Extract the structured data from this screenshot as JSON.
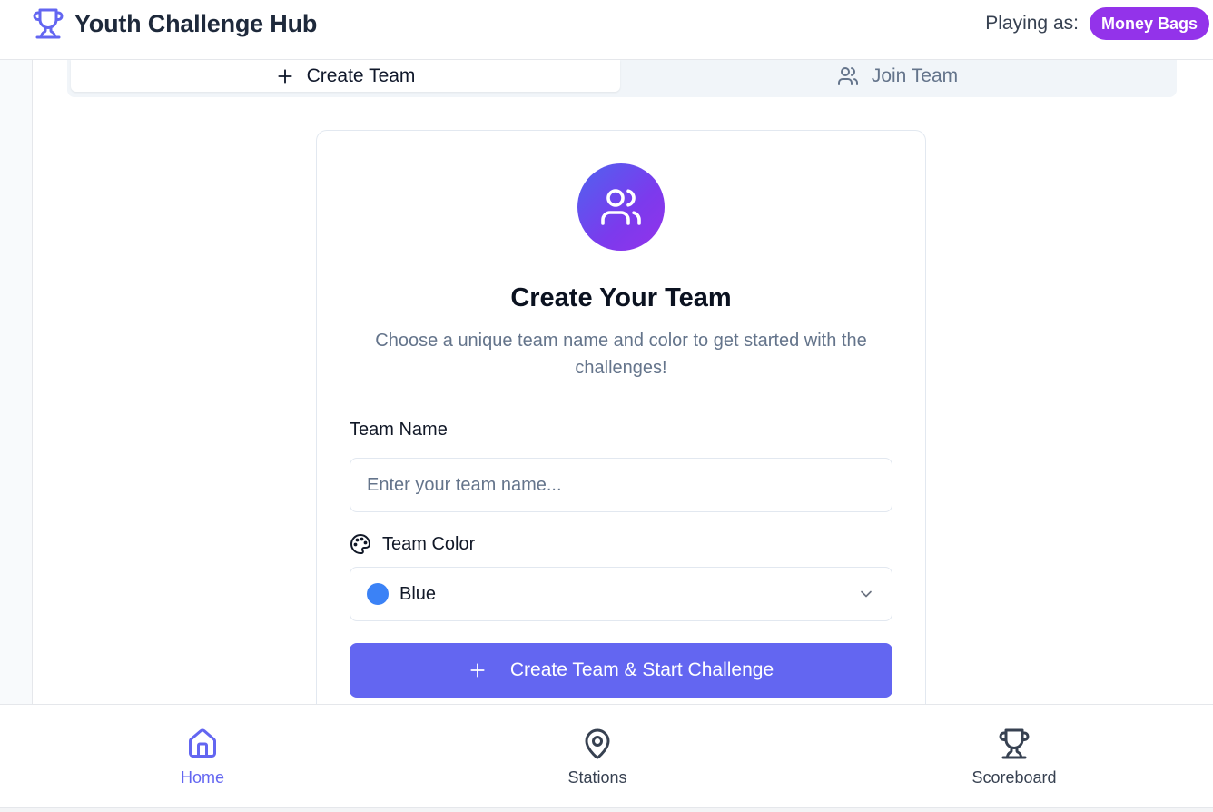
{
  "header": {
    "title": "Youth Challenge Hub",
    "playing_as_label": "Playing as:",
    "player_name": "Money Bags",
    "brand_icon": "trophy-icon"
  },
  "tabs": [
    {
      "label": "Create Team",
      "icon": "plus-icon",
      "active": true
    },
    {
      "label": "Join Team",
      "icon": "users-icon",
      "active": false
    }
  ],
  "card": {
    "icon": "users-icon",
    "title": "Create Your Team",
    "subtitle": "Choose a unique team name and color to get started with the challenges!",
    "team_name_label": "Team Name",
    "team_name_placeholder": "Enter your team name...",
    "team_name_value": "",
    "team_color_label": "Team Color",
    "team_color_icon": "palette-icon",
    "team_color_value": "Blue",
    "team_color_swatch": "#3b82f6",
    "submit_label": "Create Team & Start Challenge"
  },
  "nav": [
    {
      "label": "Home",
      "icon": "home-icon",
      "active": true
    },
    {
      "label": "Stations",
      "icon": "map-pin-icon",
      "active": false
    },
    {
      "label": "Scoreboard",
      "icon": "trophy-icon",
      "active": false
    }
  ],
  "colors": {
    "accent": "#6366f1",
    "badge": "#9333ea",
    "avatar_gradient_start": "#4f63ef",
    "avatar_gradient_end": "#9333ea"
  }
}
